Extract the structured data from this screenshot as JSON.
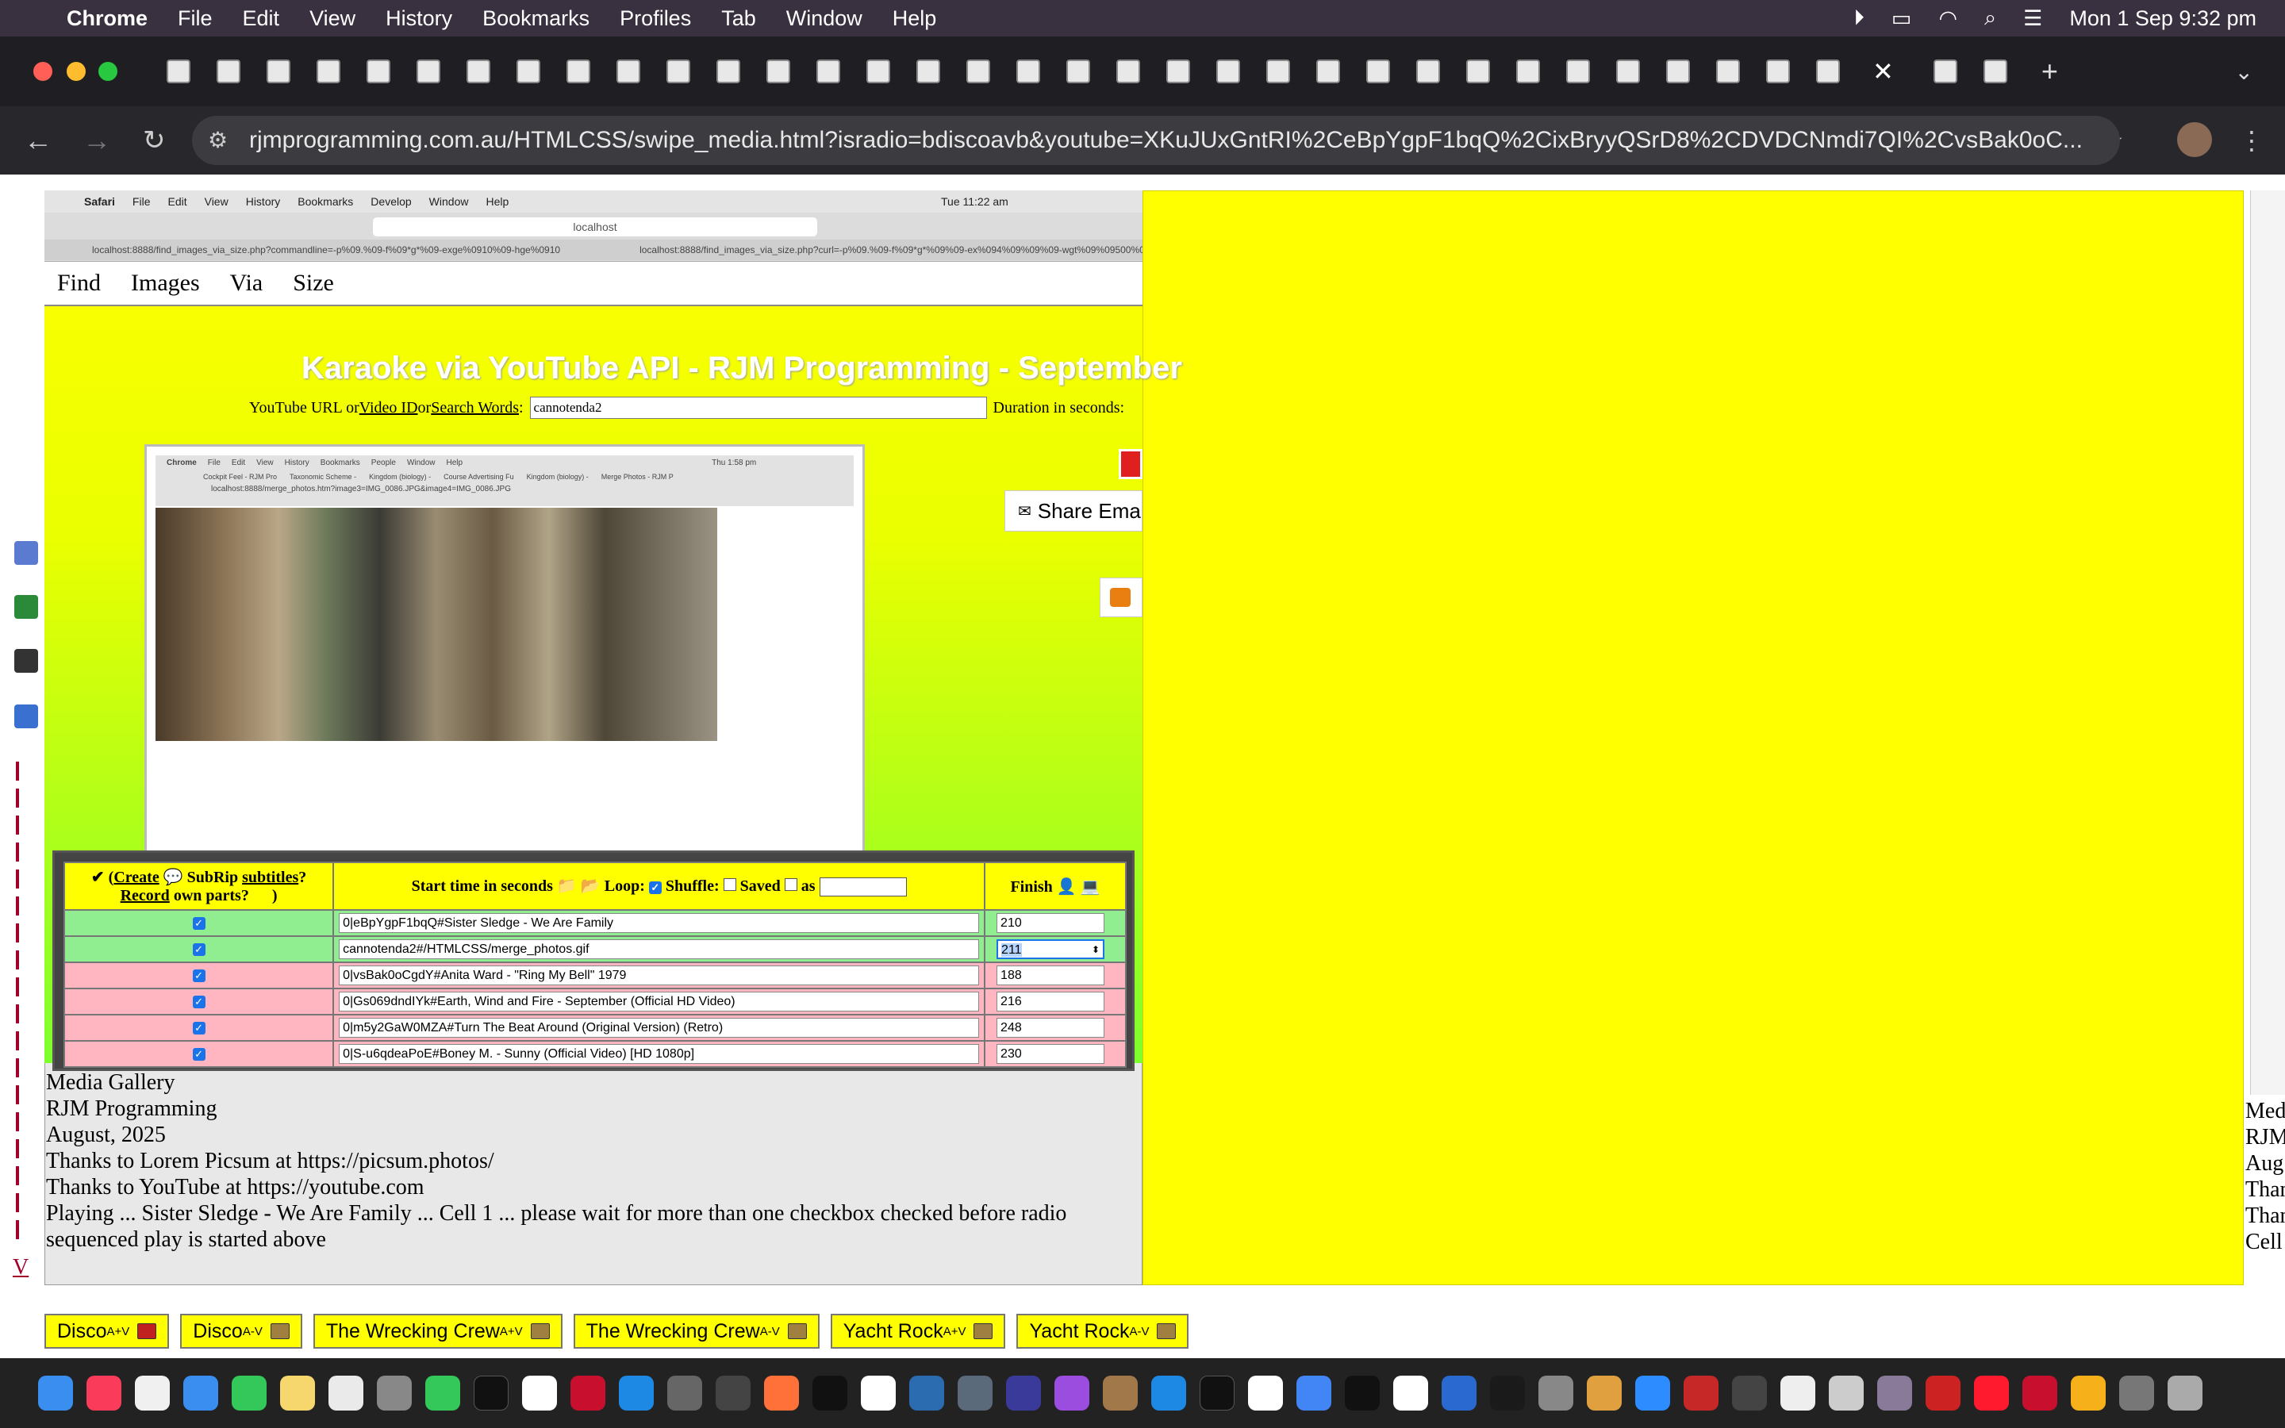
{
  "menubar": {
    "app": "Chrome",
    "items": [
      "File",
      "Edit",
      "View",
      "History",
      "Bookmarks",
      "Profiles",
      "Tab",
      "Window",
      "Help"
    ],
    "clock": "Mon 1 Sep  9:32 pm"
  },
  "browser": {
    "url": "rjmprogramming.com.au/HTMLCSS/swipe_media.html?isradio=bdiscoavb&youtube=XKuJUxGntRI%2CeBpYgpF1bqQ%2CixBryyQSrD8%2CDVDCNmdi7QI%2CvsBak0oC..."
  },
  "inner": {
    "safari_menu": [
      "Safari",
      "File",
      "Edit",
      "View",
      "History",
      "Bookmarks",
      "Develop",
      "Window",
      "Help"
    ],
    "safari_clock": "Tue 11:22 am",
    "safari_address": "localhost",
    "safari_tab1": "localhost:8888/find_images_via_size.php?commandline=-p%09.%09-f%09*g*%09-exge%0910%09-hge%0910",
    "safari_tab2": "localhost:8888/find_images_via_size.php?curl=-p%09.%09-f%09*g*%09%09-ex%094%09%09%09-wgt%09%09500%09...",
    "nav": [
      "Find",
      "Images",
      "Via",
      "Size"
    ],
    "karaoke_title": "Karaoke via YouTube API - RJM Programming - September",
    "url_label_pre": "YouTube URL or ",
    "url_link1": "Video ID",
    "url_mid": " or ",
    "url_link2": "Search Words",
    "url_colon": ":",
    "url_value": "cannotenda2",
    "duration_label": "Duration in seconds:",
    "share_label": "Share Ema",
    "pic_url": "localhost:8888/merge_photos.htm?image3=IMG_0086.JPG&image4=IMG_0086.JPG",
    "pic_clock": "Thu 1:58 pm",
    "pic_menu": [
      "Chrome",
      "File",
      "Edit",
      "View",
      "History",
      "Bookmarks",
      "People",
      "Window",
      "Help"
    ],
    "pic_tabs": [
      "Cockpit Feel - RJM Pro",
      "Taxonomic Scheme -",
      "Kingdom (biology) -",
      "Course Advertising Fu",
      "Kingdom (biology) -",
      "Merge Photos - RJM P"
    ]
  },
  "table": {
    "h1_check": "✔",
    "h1_open": "(",
    "h1_create": "Create",
    "h1_subrip": " SubRip ",
    "h1_subtitles": "subtitles",
    "h1_q": "?",
    "h1_record": "Record",
    "h1_rest": " own parts?",
    "h1_close": ")",
    "h2_label": "Start time in seconds",
    "h2_loop": "Loop:",
    "h2_shuffle": "Shuffle:",
    "h2_saved": "Saved",
    "h2_as": "as",
    "h3_label": "Finish",
    "rows": [
      {
        "start": "0|eBpYgpF1bqQ#Sister Sledge - We Are Family",
        "finish": "210",
        "color": "g"
      },
      {
        "start": "cannotenda2#/HTMLCSS/merge_photos.gif",
        "finish": "211",
        "color": "g"
      },
      {
        "start": "0|vsBak0oCgdY#Anita Ward - \"Ring My Bell\" 1979",
        "finish": "188",
        "color": "p"
      },
      {
        "start": "0|Gs069dndIYk#Earth, Wind and Fire - September (Official HD Video)",
        "finish": "216",
        "color": "p"
      },
      {
        "start": "0|m5y2GaW0MZA#Turn The Beat Around (Original Version) (Retro)",
        "finish": "248",
        "color": "p"
      },
      {
        "start": "0|S-u6qdeaPoE#Boney M. - Sunny (Official Video) [HD 1080p]",
        "finish": "230",
        "color": "p"
      }
    ]
  },
  "info": {
    "l1": "Media Gallery",
    "l2": "RJM Programming",
    "l3": "August, 2025",
    "l4": "Thanks to Lorem Picsum at https://picsum.photos/",
    "l5": "Thanks to YouTube at https://youtube.com",
    "l6": "Playing ... Sister Sledge - We Are Family ... Cell 1 ... please wait for more than one checkbox checked before radio sequenced play is started above"
  },
  "right_info": [
    "Med",
    "RJM",
    "Aug",
    "Than",
    "Than",
    "Cell"
  ],
  "left_letter": "V",
  "bottom_buttons": [
    {
      "label": "Disco",
      "mark": "A+V",
      "pos": "sup"
    },
    {
      "label": "Disco",
      "mark": "A-V",
      "pos": "sub"
    },
    {
      "label": "The Wrecking Crew",
      "mark": "A+V",
      "pos": "sup"
    },
    {
      "label": "The Wrecking Crew",
      "mark": "A-V",
      "pos": "sub"
    },
    {
      "label": "Yacht Rock",
      "mark": "A+V",
      "pos": "sup"
    },
    {
      "label": "Yacht Rock",
      "mark": "A-V",
      "pos": "sub"
    }
  ],
  "colors": {
    "page_yellow": "#ffff00",
    "row_green": "#90ee90",
    "row_pink": "#ffb6c1"
  }
}
